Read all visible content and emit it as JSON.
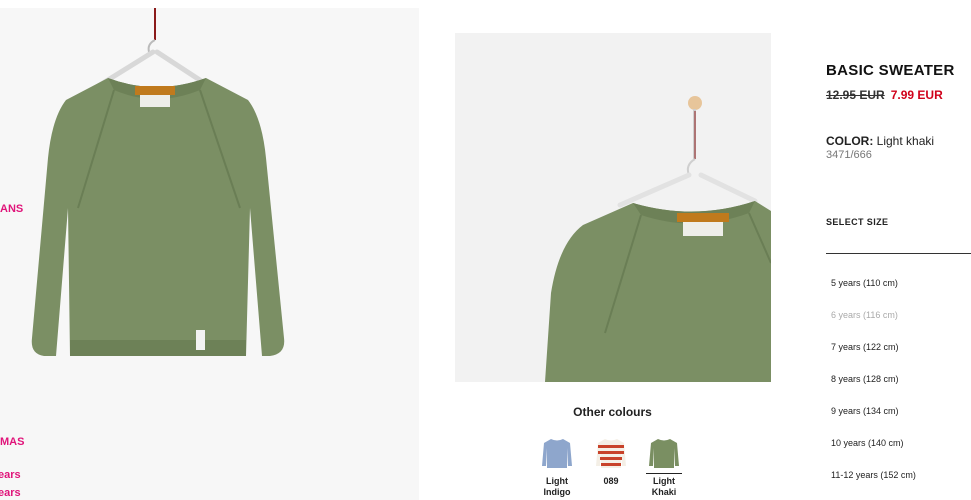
{
  "sidenav": {
    "items": [
      {
        "label": "ANS"
      },
      {
        "label": "MAS"
      },
      {
        "label": "ears"
      },
      {
        "label": "ears"
      }
    ]
  },
  "product": {
    "title": "BASIC SWEATER",
    "price_old": "12.95 EUR",
    "price_new": "7.99 EUR",
    "color_label": "COLOR:",
    "color_value": "Light khaki",
    "reference": "3471/666"
  },
  "colours": {
    "title": "Other colours",
    "items": [
      {
        "label": "Light Indigo",
        "color": "#8ea6cc",
        "icon": "sweater-icon"
      },
      {
        "label": "089",
        "color": "#c8422a",
        "icon": "striped-sweater-icon"
      },
      {
        "label": "Light Khaki",
        "color": "#7a8f62",
        "icon": "sweater-icon"
      }
    ]
  },
  "sizes": {
    "label": "SELECT SIZE",
    "items": [
      {
        "label": "5 years (110 cm)",
        "available": true
      },
      {
        "label": "6 years (116 cm)",
        "available": false
      },
      {
        "label": "7 years (122 cm)",
        "available": true
      },
      {
        "label": "8 years (128 cm)",
        "available": true
      },
      {
        "label": "9 years (134 cm)",
        "available": true
      },
      {
        "label": "10 years (140 cm)",
        "available": true
      },
      {
        "label": "11-12 years (152 cm)",
        "available": true
      }
    ]
  },
  "colors": {
    "accent": "#e0147a",
    "sale": "#d0021b",
    "sweater": "#7b8f64"
  }
}
